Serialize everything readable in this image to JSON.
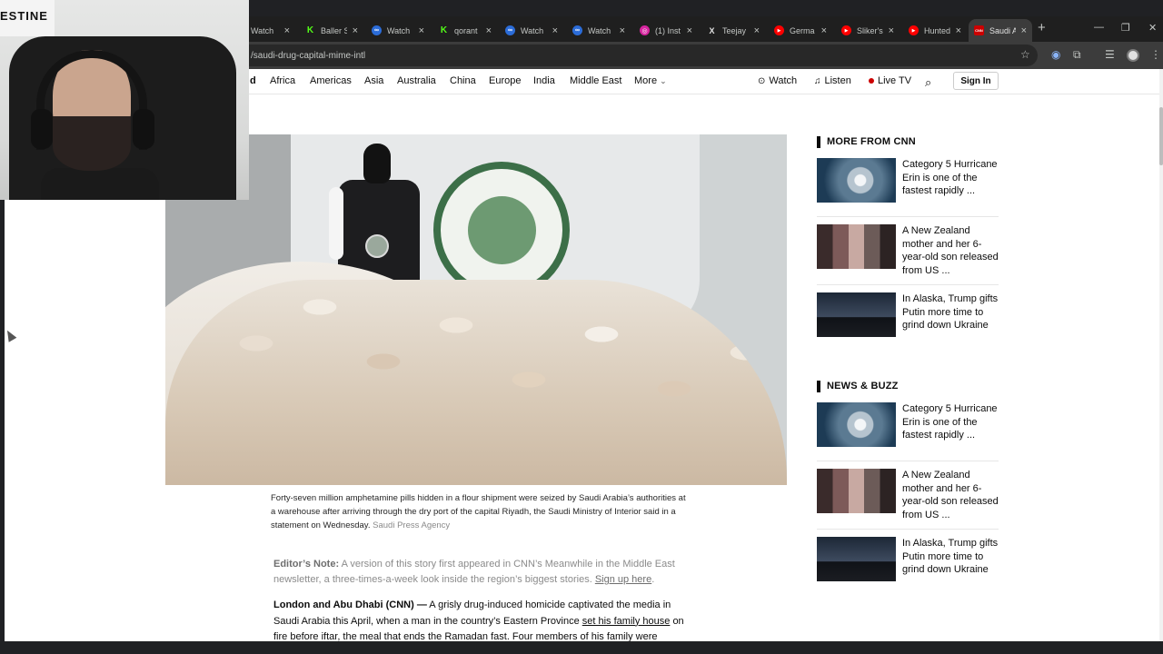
{
  "browser": {
    "tabs": [
      {
        "title": "Watch",
        "color": "#3c3c3c"
      },
      {
        "title": "Baller S",
        "color": "#53fc18",
        "glyph": "K"
      },
      {
        "title": "Watch",
        "color": "#2b6cd8",
        "glyph": "∞"
      },
      {
        "title": "qorant",
        "color": "#53fc18",
        "glyph": "K"
      },
      {
        "title": "Watch",
        "color": "#2b6cd8",
        "glyph": "∞"
      },
      {
        "title": "Watch",
        "color": "#2b6cd8",
        "glyph": "∞"
      },
      {
        "title": "(1) Inst",
        "color": "#d6249f",
        "glyph": "◎"
      },
      {
        "title": "Teejay",
        "color": "#3c3c3c",
        "glyph": "X"
      },
      {
        "title": "Germa",
        "color": "#ff0000",
        "glyph": "▶"
      },
      {
        "title": "Sliker's",
        "color": "#ff0000",
        "glyph": "▶"
      },
      {
        "title": "Hunted",
        "color": "#ff0000",
        "glyph": "▶"
      },
      {
        "title": "Saudi A",
        "color": "#cc0000",
        "glyph": "CNN",
        "active": true
      }
    ],
    "url": "/saudi-drug-capital-mime-intl"
  },
  "nav": {
    "logo_fragment": "d",
    "items": [
      "Africa",
      "Americas",
      "Asia",
      "Australia",
      "China",
      "Europe",
      "India",
      "Middle East",
      "More"
    ],
    "watch": "Watch",
    "listen": "Listen",
    "live_tv": "Live TV",
    "sign_in": "Sign In"
  },
  "article": {
    "caption": "Forty-seven million amphetamine pills hidden in a flour shipment were seized by Saudi Arabia’s authorities at a warehouse after arriving through the dry port of the capital Riyadh, the Saudi Ministry of Interior said in a statement on Wednesday.",
    "caption_credit": "Saudi Press Agency",
    "editor_label": "Editor’s Note:",
    "editor_text": "A version of this story first appeared in CNN’s Meanwhile in the Middle East newsletter, a three-times-a-week look inside the region’s biggest stories.",
    "editor_link": "Sign up here",
    "dateline": "London and Abu Dhabi (CNN) —",
    "body_1": "A grisly drug-induced homicide captivated the media in Saudi Arabia this April, when a man in the country’s Eastern Province",
    "body_link": "set his family house",
    "body_2": "on fire before iftar, the meal that ends the Ramadan fast. Four members of his family were"
  },
  "sidebar": {
    "more_heading": "MORE FROM CNN",
    "news_heading": "NEWS & BUZZ",
    "more_items": [
      {
        "headline": "Category 5 Hurricane Erin is one of the fastest rapidly ..."
      },
      {
        "headline": "A New Zealand mother and her 6-year-old son released from US ..."
      },
      {
        "headline": "In Alaska, Trump gifts Putin more time to grind down Ukraine"
      }
    ],
    "news_items": [
      {
        "headline": "Category 5 Hurricane Erin is one of the fastest rapidly ..."
      },
      {
        "headline": "A New Zealand mother and her 6-year-old son released from US ..."
      },
      {
        "headline": "In Alaska, Trump gifts Putin more time to grind down Ukraine"
      }
    ]
  },
  "webcam": {
    "banner_text": "ESTINE"
  },
  "icons": {
    "search": "search-icon",
    "watch": "play-circle-icon",
    "listen": "headphones-icon",
    "star": "star-icon"
  }
}
